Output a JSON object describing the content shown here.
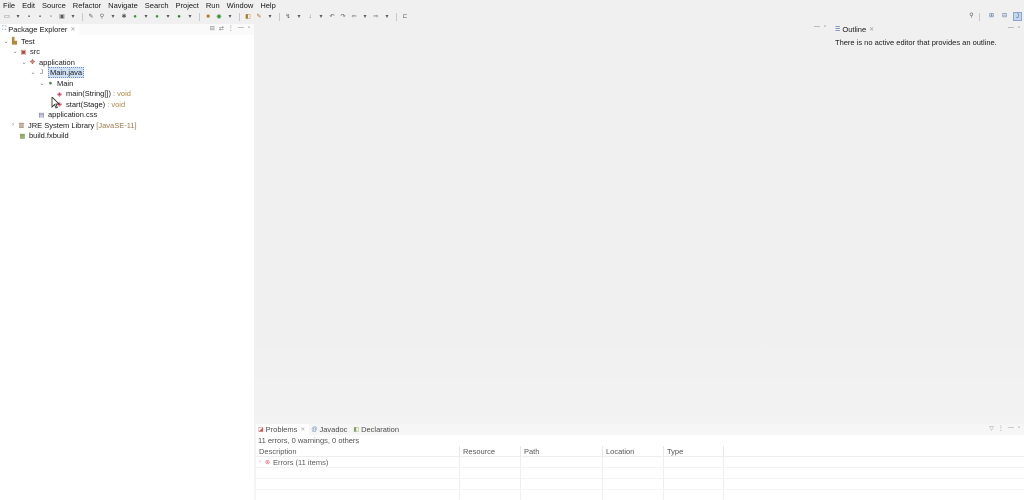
{
  "menu": [
    "File",
    "Edit",
    "Source",
    "Refactor",
    "Navigate",
    "Search",
    "Project",
    "Run",
    "Window",
    "Help"
  ],
  "package_explorer": {
    "title": "Package Explorer",
    "tree": {
      "project": "Test",
      "src": "src",
      "package": "application",
      "file_main": "Main.java",
      "class_main": "Main",
      "method_main": "main(String[])",
      "method_main_ret": ": void",
      "method_start": "start(Stage)",
      "method_start_ret": ": void",
      "file_css": "application.css",
      "jre": "JRE System Library",
      "jre_tag": "[JavaSE-11]",
      "fxbuild": "build.fxbuild"
    }
  },
  "outline": {
    "title": "Outline",
    "message": "There is no active editor that provides an outline."
  },
  "bottom_panel": {
    "tabs": [
      "Problems",
      "Javadoc",
      "Declaration"
    ],
    "summary": "11 errors, 0 warnings, 0 others",
    "columns": [
      "Description",
      "Resource",
      "Path",
      "Location",
      "Type"
    ],
    "rows": [
      {
        "description": "Errors (11 items)",
        "resource": "",
        "path": "",
        "location": "",
        "type": ""
      }
    ]
  }
}
